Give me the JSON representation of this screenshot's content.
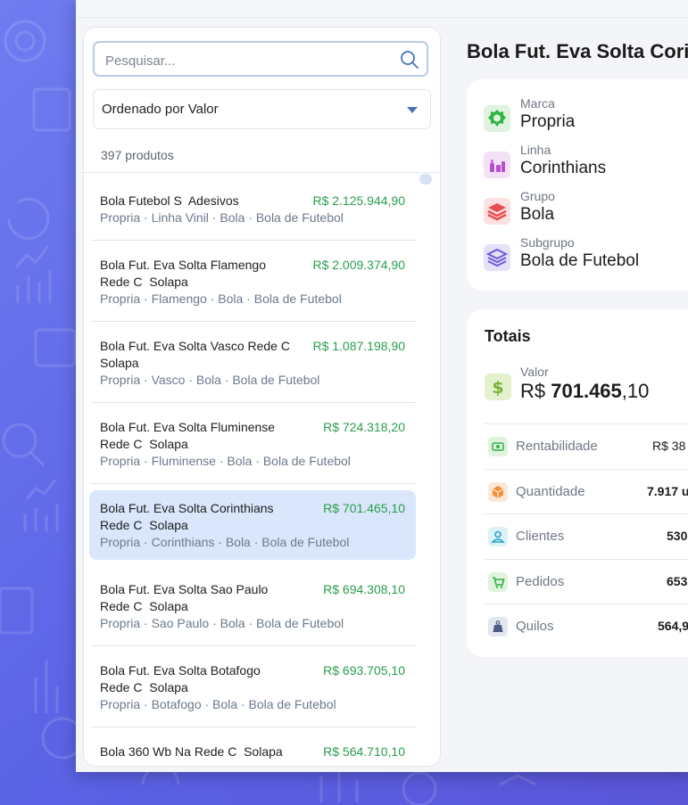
{
  "search": {
    "placeholder": "Pesquisar..."
  },
  "sort": {
    "label": "Ordenado por Valor"
  },
  "count": "397 produtos",
  "products": [
    {
      "name": "Bola Futebol S  Adesivos",
      "price": "R$ 2.125.944,90",
      "meta": "Propria · Linha Vinil · Bola · Bola de Futebol"
    },
    {
      "name": "Bola Fut. Eva Solta Flamengo Rede C  Solapa",
      "price": "R$ 2.009.374,90",
      "meta": "Propria · Flamengo · Bola · Bola de Futebol"
    },
    {
      "name": "Bola Fut. Eva Solta Vasco Rede C  Solapa",
      "price": "R$ 1.087.198,90",
      "meta": "Propria · Vasco · Bola · Bola de Futebol"
    },
    {
      "name": "Bola Fut. Eva Solta Fluminense Rede C  Solapa",
      "price": "R$ 724.318,20",
      "meta": "Propria · Fluminense · Bola · Bola de Futebol"
    },
    {
      "name": "Bola Fut. Eva Solta Corinthians Rede C  Solapa",
      "price": "R$ 701.465,10",
      "meta": "Propria · Corinthians · Bola · Bola de Futebol"
    },
    {
      "name": "Bola Fut. Eva Solta Sao Paulo Rede C  Solapa",
      "price": "R$ 694.308,10",
      "meta": "Propria · Sao Paulo · Bola · Bola de Futebol"
    },
    {
      "name": "Bola Fut. Eva Solta Botafogo Rede C  Solapa",
      "price": "R$ 693.705,10",
      "meta": "Propria · Botafogo · Bola · Bola de Futebol"
    },
    {
      "name": "Bola 360 Wb Na Rede C  Solapa",
      "price": "R$ 564.710,10",
      "meta": ""
    }
  ],
  "detail": {
    "title": "Bola Fut. Eva Solta Cori",
    "attributes": [
      {
        "key": "Marca",
        "value": "Propria",
        "icon": "brand-badge-icon",
        "color": "#2fb344"
      },
      {
        "key": "Linha",
        "value": "Corinthians",
        "icon": "bottles-icon",
        "color": "#b94fcf"
      },
      {
        "key": "Grupo",
        "value": "Bola",
        "icon": "layers-icon",
        "color": "#e74c4c"
      },
      {
        "key": "Subgrupo",
        "value": "Bola de Futebol",
        "icon": "stack-icon",
        "color": "#6b5bd6"
      }
    ],
    "totals": {
      "heading": "Totais",
      "valor_label": "Valor",
      "valor_prefix": "R$ ",
      "valor_main": "701.465",
      "valor_cents": ",10",
      "kpis": [
        {
          "label": "Rentabilidade",
          "value": "R$ 38",
          "icon": "money-icon",
          "color": "#2fb344"
        },
        {
          "label": "Quantidade",
          "value": "7.917 u",
          "icon": "box-icon",
          "color": "#f0903a"
        },
        {
          "label": "Clientes",
          "value": "530",
          "icon": "user-icon",
          "color": "#2aa5c9"
        },
        {
          "label": "Pedidos",
          "value": "653",
          "icon": "cart-icon",
          "color": "#2fb344"
        },
        {
          "label": "Quilos",
          "value": "564,9",
          "icon": "weight-icon",
          "color": "#4b5d86"
        }
      ]
    }
  }
}
